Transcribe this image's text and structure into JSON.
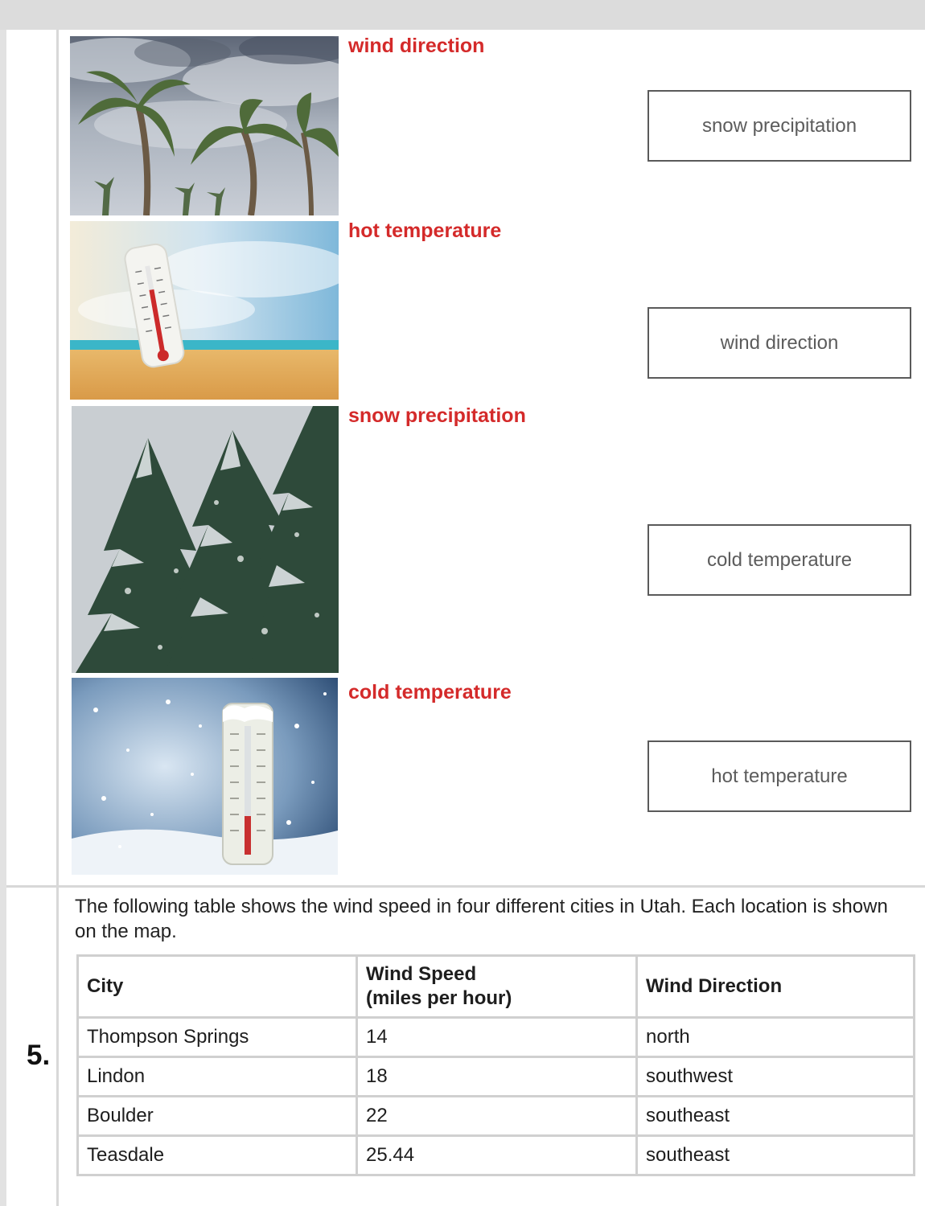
{
  "matching": {
    "images": [
      {
        "label": "wind direction",
        "image": "windy-palm-trees"
      },
      {
        "label": "hot temperature",
        "image": "thermometer-on-beach"
      },
      {
        "label": "snow precipitation",
        "image": "snowy-pine-trees"
      },
      {
        "label": "cold temperature",
        "image": "thermometer-in-snow"
      }
    ],
    "targets": [
      "snow precipitation",
      "wind direction",
      "cold temperature",
      "hot temperature"
    ]
  },
  "question": {
    "number": "5.",
    "intro": "The following table shows the wind speed in four different cities in Utah. Each location is shown on the map."
  },
  "table": {
    "headers": {
      "city": "City",
      "speed_line1": "Wind Speed",
      "speed_line2": "(miles per hour)",
      "direction": "Wind Direction"
    },
    "rows": [
      {
        "city": "Thompson Springs",
        "speed": "14",
        "direction": "north"
      },
      {
        "city": "Lindon",
        "speed": "18",
        "direction": "southwest"
      },
      {
        "city": "Boulder",
        "speed": "22",
        "direction": "southeast"
      },
      {
        "city": "Teasdale",
        "speed": "25.44",
        "direction": "southeast"
      }
    ]
  },
  "colors": {
    "label_red": "#d42a2a",
    "box_border": "#5a5a5a",
    "table_border": "#d0d0d0"
  }
}
